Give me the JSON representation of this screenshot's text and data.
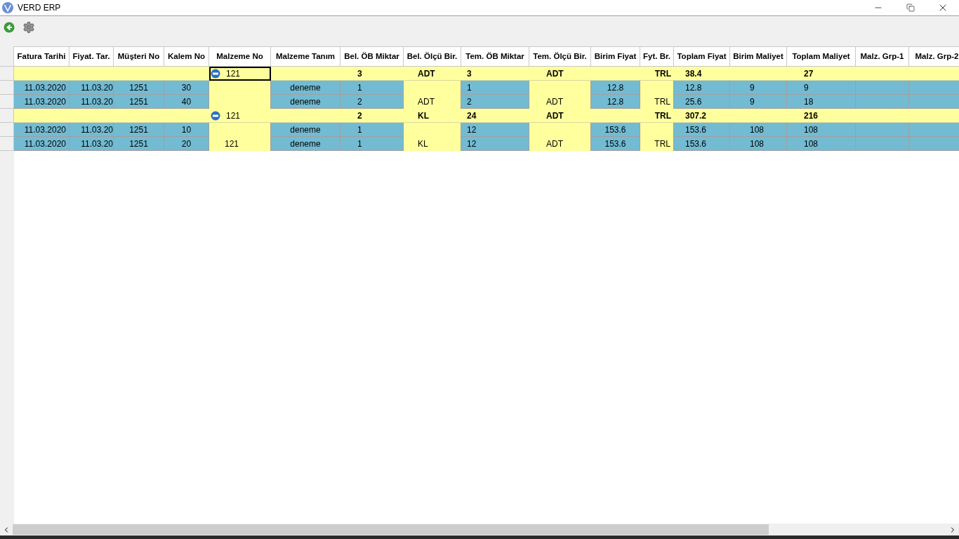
{
  "window": {
    "title": "VERD ERP"
  },
  "toolbar": {
    "buttons": [
      {
        "kind": "back"
      },
      {
        "kind": "settings"
      }
    ]
  },
  "grid": {
    "columns": [
      {
        "label": "Fatura Tarihi",
        "grouping": false
      },
      {
        "label": "Fiyat. Tar.",
        "grouping": false
      },
      {
        "label": "Müşteri No",
        "grouping": false
      },
      {
        "label": "Kalem No",
        "grouping": false
      },
      {
        "label": "Malzeme No",
        "grouping": true
      },
      {
        "label": "Malzeme Tanım",
        "grouping": false
      },
      {
        "label": "Bel. ÖB Miktar",
        "grouping": false
      },
      {
        "label": "Bel. Ölçü Bir.",
        "grouping": true
      },
      {
        "label": "Tem. ÖB Miktar",
        "grouping": false
      },
      {
        "label": "Tem. Ölçü Bir.",
        "grouping": true
      },
      {
        "label": "Birim Fiyat",
        "grouping": false
      },
      {
        "label": "Fyt. Br.",
        "grouping": true
      },
      {
        "label": "Toplam Fiyat",
        "grouping": false
      },
      {
        "label": "Birim Maliyet",
        "grouping": false
      },
      {
        "label": "Toplam Maliyet",
        "grouping": false
      },
      {
        "label": "Malz. Grp-1",
        "grouping": false
      },
      {
        "label": "Malz. Grp-2",
        "grouping": false
      }
    ],
    "rows": [
      {
        "kind": "group",
        "expanded": true,
        "focused": true,
        "cells": [
          null,
          null,
          null,
          null,
          "121",
          null,
          "3",
          "ADT",
          "3",
          "ADT",
          null,
          "TRL",
          "38.4",
          null,
          "27",
          null,
          null
        ]
      },
      {
        "kind": "detail",
        "cells": [
          "11.03.2020",
          "11.03.20",
          "1251",
          "30",
          null,
          "deneme",
          "1",
          null,
          "1",
          null,
          "12.8",
          null,
          "12.8",
          "9",
          "9",
          null,
          null
        ]
      },
      {
        "kind": "detail",
        "cells": [
          "11.03.2020",
          "11.03.20",
          "1251",
          "40",
          null,
          "deneme",
          "2",
          "ADT",
          "2",
          "ADT",
          "12.8",
          "TRL",
          "25.6",
          "9",
          "18",
          null,
          null
        ]
      },
      {
        "kind": "group",
        "expanded": true,
        "focused": false,
        "cells": [
          null,
          null,
          null,
          null,
          "121",
          null,
          "2",
          "KL",
          "24",
          "ADT",
          null,
          "TRL",
          "307.2",
          null,
          "216",
          null,
          null
        ]
      },
      {
        "kind": "detail",
        "cells": [
          "11.03.2020",
          "11.03.20",
          "1251",
          "10",
          null,
          "deneme",
          "1",
          null,
          "12",
          null,
          "153.6",
          null,
          "153.6",
          "108",
          "108",
          null,
          null
        ]
      },
      {
        "kind": "detail",
        "cells": [
          "11.03.2020",
          "11.03.20",
          "1251",
          "20",
          "121",
          "deneme",
          "1",
          "KL",
          "12",
          "ADT",
          "153.6",
          "TRL",
          "153.6",
          "108",
          "108",
          null,
          null
        ]
      }
    ]
  }
}
